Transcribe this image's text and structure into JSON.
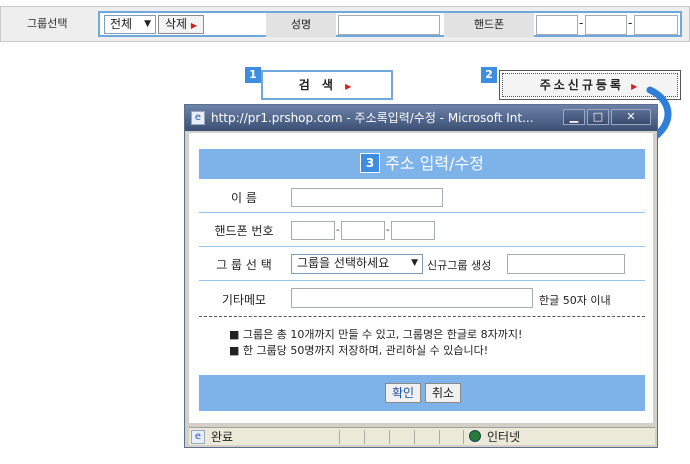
{
  "search_bar": {
    "group_label": "그룹선택",
    "group_select_value": "전체",
    "delete_label": "삭제",
    "name_label": "성명",
    "phone_label": "핸드폰",
    "name_value": "",
    "phone_parts": [
      "",
      "",
      ""
    ]
  },
  "markers": [
    "1",
    "2",
    "3"
  ],
  "search_button": {
    "label": "검 색"
  },
  "new_address_button": {
    "label": "주소신규등록"
  },
  "popup": {
    "title": "http://pr1.prshop.com - 주소록입력/수정 - Microsoft Int...",
    "heading": "주소 입력/수정",
    "fields": {
      "name_label": "이 름",
      "name_value": "",
      "phone_label": "핸드폰 번호",
      "phone_parts": [
        "",
        "",
        ""
      ],
      "group_label": "그 룹 선 택",
      "group_select_value": "그룹을 선택하세요",
      "new_group_label": "신규그룹 생성",
      "new_group_value": "",
      "memo_label": "기타메모",
      "memo_value": "",
      "memo_hint": "한글 50자 이내"
    },
    "notes": [
      "그룹은 총 10개까지 만들 수 있고, 그룹명은 한글로 8자까지!",
      "한 그룹당 50명까지 저장하며, 관리하실 수 있습니다!"
    ],
    "confirm_label": "확인",
    "cancel_label": "취소",
    "status_text": "완료",
    "zone_text": "인터넷"
  },
  "colors": {
    "accent": "#7eb3ea",
    "border_blue": "#6fa8dc",
    "marker": "#3d8de0"
  }
}
